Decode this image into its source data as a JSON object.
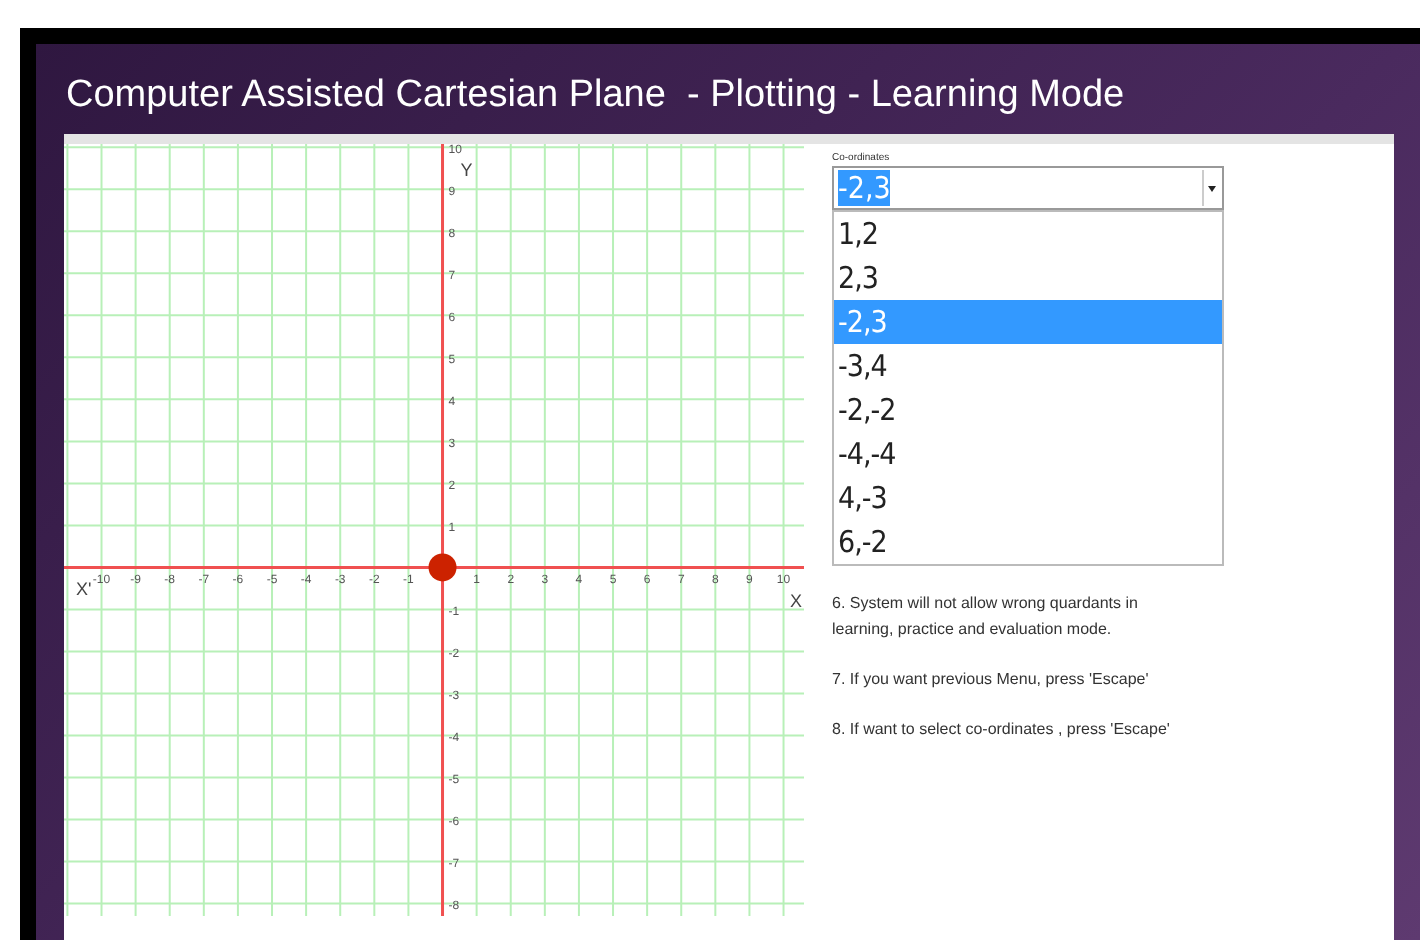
{
  "window": {
    "title": "Computer Assisted Cartesian Plane  - Plotting - Learning Mode"
  },
  "graph": {
    "x_negative_label": "X'",
    "chart_data": {
      "type": "scatter",
      "grid": true,
      "xlabel": "X",
      "ylabel": "Y",
      "x": [
        0
      ],
      "series": [
        {
          "color": "#cc2200",
          "values": [
            0
          ]
        }
      ],
      "xlim": [
        -11.1,
        10.6
      ],
      "ylim": [
        -8.3,
        10.08
      ],
      "xticks": [
        -10,
        -9,
        -8,
        -7,
        -6,
        -5,
        -4,
        -3,
        -2,
        -1,
        1,
        2,
        3,
        4,
        5,
        6,
        7,
        8,
        9,
        10
      ],
      "yticks": [
        -8,
        -7,
        -6,
        -5,
        -4,
        -3,
        -2,
        -1,
        1,
        2,
        3,
        4,
        5,
        6,
        7,
        8,
        9,
        10
      ]
    }
  },
  "coordinates": {
    "label": "Co-ordinates",
    "value": "-2,3",
    "options": [
      {
        "label": "1,2",
        "selected": false
      },
      {
        "label": "2,3",
        "selected": false
      },
      {
        "label": "-2,3",
        "selected": true
      },
      {
        "label": "-3,4",
        "selected": false
      },
      {
        "label": "-2,-2",
        "selected": false
      },
      {
        "label": "-4,-4",
        "selected": false
      },
      {
        "label": "4,-3",
        "selected": false
      },
      {
        "label": "6,-2",
        "selected": false
      }
    ]
  },
  "notes": [
    "6. System will not allow wrong quardants in learning, practice and evaluation mode.",
    "7. If you want previous Menu, press 'Escape'",
    "8. If want to select co-ordinates , press 'Escape'"
  ]
}
